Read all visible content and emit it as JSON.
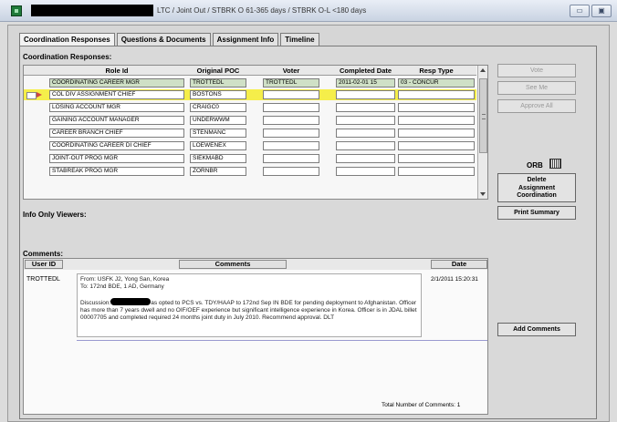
{
  "window": {
    "title": "LTC / Joint Out / STBRK O 61-365 days / STBRK O-L <180 days",
    "controls": [
      "▭",
      "▣"
    ]
  },
  "tabs": [
    {
      "label": "Coordination Responses",
      "active": true
    },
    {
      "label": "Questions & Documents",
      "active": false
    },
    {
      "label": "Assignment Info",
      "active": false
    },
    {
      "label": "Timeline",
      "active": false
    }
  ],
  "coordination": {
    "section_label": "Coordination Responses:",
    "columns": [
      "Role Id",
      "Original POC",
      "Voter",
      "Completed Date",
      "Resp Type"
    ],
    "rows": [
      {
        "role": "COORDINATING CAREER MGR",
        "poc": "TROTTEDL",
        "voter": "TROTTEDL",
        "date": "2011-02-01 15",
        "resp": "03 - CONCUR",
        "state": "done"
      },
      {
        "role": "COL DIV ASSIGNMENT CHIEF",
        "poc": "BOSTONS",
        "voter": "",
        "date": "",
        "resp": "",
        "state": "selected"
      },
      {
        "role": "LOSING ACCOUNT MGR",
        "poc": "CRAIGC0",
        "voter": "",
        "date": "",
        "resp": "",
        "state": ""
      },
      {
        "role": "GAINING ACCOUNT MANAGER",
        "poc": "UNDERWWM",
        "voter": "",
        "date": "",
        "resp": "",
        "state": ""
      },
      {
        "role": "CAREER BRANCH CHIEF",
        "poc": "STENMANC",
        "voter": "",
        "date": "",
        "resp": "",
        "state": ""
      },
      {
        "role": "COORDINATING CAREER DI CHIEF",
        "poc": "LOEWENEX",
        "voter": "",
        "date": "",
        "resp": "",
        "state": ""
      },
      {
        "role": "JOINT-OUT PROG MGR",
        "poc": "SIEKMABD",
        "voter": "",
        "date": "",
        "resp": "",
        "state": ""
      },
      {
        "role": "STABREAK PROG MGR",
        "poc": "ZORNBR",
        "voter": "",
        "date": "",
        "resp": "",
        "state": ""
      }
    ]
  },
  "side_buttons": {
    "vote": "Vote",
    "see_me": "See Me",
    "approve_all": "Approve All",
    "orb_label": "ORB",
    "delete_lines": [
      "Delete",
      "Assignment",
      "Coordination"
    ],
    "print_summary": "Print Summary",
    "add_comments": "Add Comments"
  },
  "info_only": {
    "label": "Info Only Viewers:"
  },
  "comments": {
    "section_label": "Comments:",
    "columns": [
      "User ID",
      "Comments",
      "Date"
    ],
    "entry": {
      "user": "TROTTEDL",
      "from": "From: USFK J2, Yong San, Korea",
      "to": "To: 172nd BDE, 1 AD, Germany",
      "discussion_prefix": "Discussion:",
      "discussion_rest": "as opted to PCS vs. TDY/HAAP to 172nd Sep IN BDE for pending deployment to Afghanistan.  Officer has more than 7 years dwell and no OIF/OEF experience but significant intelligence experience in Korea.  Officer is in JDAL billet 00007705 and completed required 24 months joint duty  in July 2010.  Recommend approval. DLT",
      "date": "2/1/2011 15:20:31"
    },
    "total": "Total Number of Comments: 1"
  }
}
